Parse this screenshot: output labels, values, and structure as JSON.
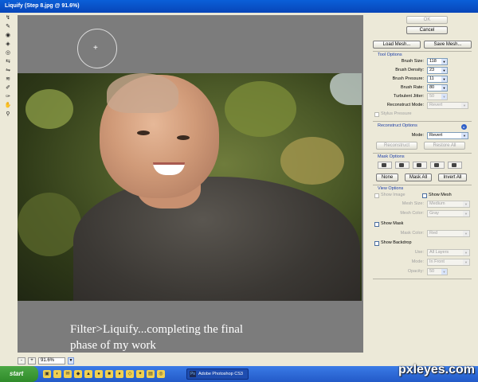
{
  "window": {
    "title": "Liquify (Step 8.jpg @ 91.6%)"
  },
  "tools": [
    "forward-warp",
    "reconstruct",
    "twirl",
    "pucker",
    "bloat",
    "push-left",
    "mirror",
    "turbulence",
    "freeze-mask",
    "thaw-mask",
    "hand",
    "zoom"
  ],
  "canvas": {
    "caption_line1": "Filter>Liquify...completing the final",
    "caption_line2": "phase of my work"
  },
  "zoom": {
    "minus": "-",
    "plus": "+",
    "value": "91.6%"
  },
  "panel": {
    "ok_label": "OK",
    "cancel_label": "Cancel",
    "load_mesh_label": "Load Mesh...",
    "save_mesh_label": "Save Mesh...",
    "tool_options": {
      "heading": "Tool Options",
      "brush_size_label": "Brush Size:",
      "brush_size": "118",
      "brush_density_label": "Brush Density:",
      "brush_density": "23",
      "brush_pressure_label": "Brush Pressure:",
      "brush_pressure": "11",
      "brush_rate_label": "Brush Rate:",
      "brush_rate": "80",
      "turbulent_jitter_label": "Turbulent Jitter:",
      "turbulent_jitter": "50",
      "reconstruct_mode_label": "Reconstruct Mode:",
      "reconstruct_mode": "Revert",
      "stylus_pressure_label": "Stylus Pressure"
    },
    "reconstruct_options": {
      "heading": "Reconstruct Options",
      "mode_label": "Mode:",
      "mode": "Revert",
      "reconstruct_label": "Reconstruct",
      "restore_all_label": "Restore All"
    },
    "mask_options": {
      "heading": "Mask Options",
      "none_label": "None",
      "mask_all_label": "Mask All",
      "invert_all_label": "Invert All"
    },
    "view_options": {
      "heading": "View Options",
      "show_image_label": "Show Image",
      "show_mesh_label": "Show Mesh",
      "mesh_size_label": "Mesh Size:",
      "mesh_size": "Medium",
      "mesh_color_label": "Mesh Color:",
      "mesh_color": "Gray",
      "show_mask_label": "Show Mask",
      "mask_color_label": "Mask Color:",
      "mask_color": "Red",
      "show_backdrop_label": "Show Backdrop",
      "use_label": "Use:",
      "use": "All Layers",
      "mode_label": "Mode:",
      "mode": "In Front",
      "opacity_label": "Opacity:",
      "opacity": "50"
    }
  },
  "taskbar": {
    "start_label": "start",
    "task_label": "Adobe Photoshop CS3",
    "watermark": "pxleyes.com"
  }
}
